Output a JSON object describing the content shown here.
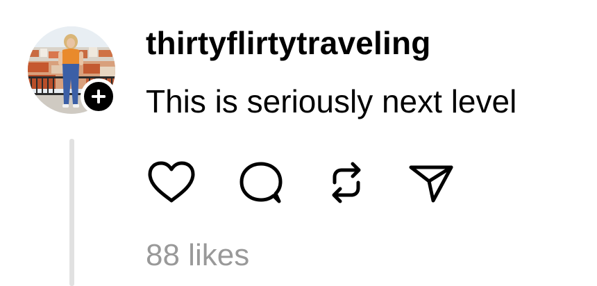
{
  "post": {
    "username": "thirtyflirtytraveling",
    "text": "This is seriously next level",
    "likes_label": "88 likes"
  },
  "avatar": {
    "icon": "profile-photo",
    "follow_icon": "plus-icon"
  },
  "actions": [
    {
      "icon": "heart-icon",
      "label": "Like"
    },
    {
      "icon": "comment-icon",
      "label": "Reply"
    },
    {
      "icon": "repost-icon",
      "label": "Repost"
    },
    {
      "icon": "send-icon",
      "label": "Share"
    }
  ],
  "colors": {
    "text": "#000000",
    "muted": "#999999",
    "thread_line": "#e1e1e1",
    "background": "#ffffff"
  }
}
